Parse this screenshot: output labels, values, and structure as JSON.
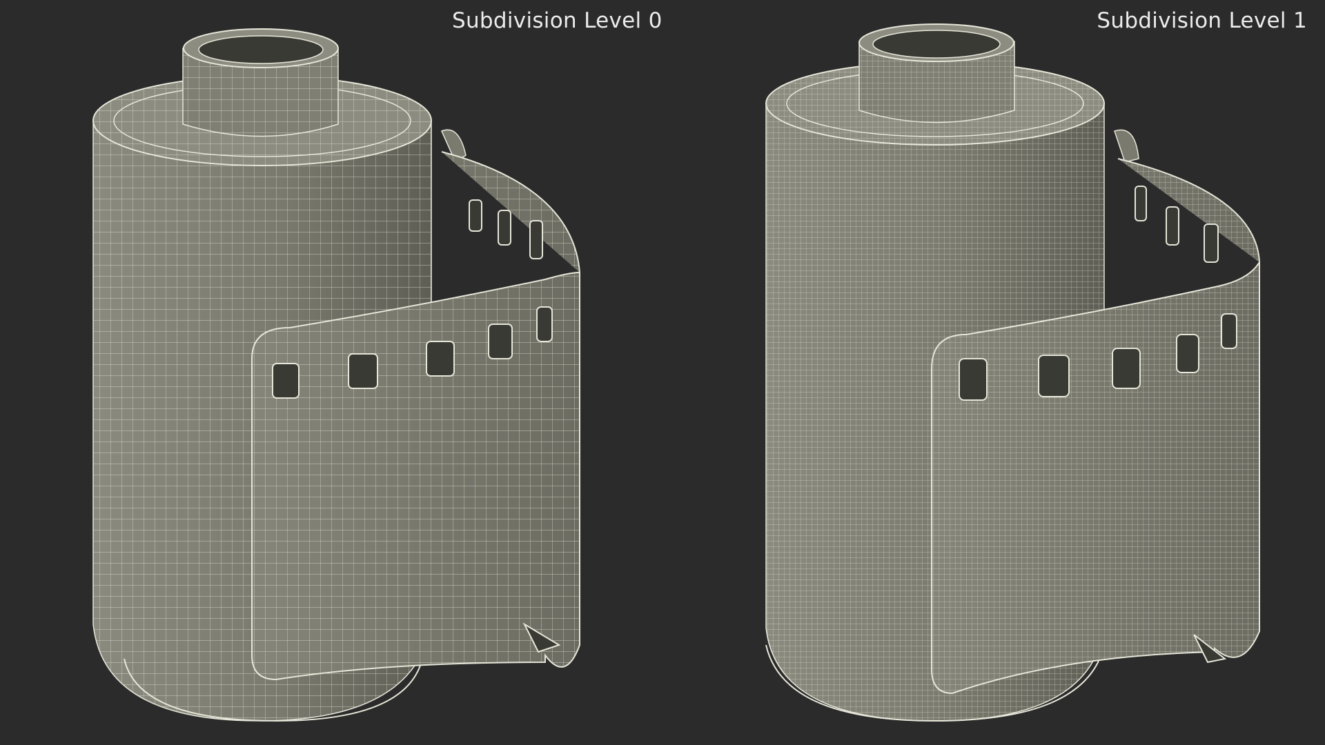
{
  "panels": [
    {
      "label": "Subdivision Level 0",
      "wire_density": "low"
    },
    {
      "label": "Subdivision Level 1",
      "wire_density": "high"
    }
  ],
  "colors": {
    "background": "#2b2b2b",
    "surface": "#7b7b70",
    "surface_light": "#8c8c80",
    "wire": "#e6e6d9",
    "label_text": "#ececec"
  },
  "subject": "film-canister-wireframe"
}
